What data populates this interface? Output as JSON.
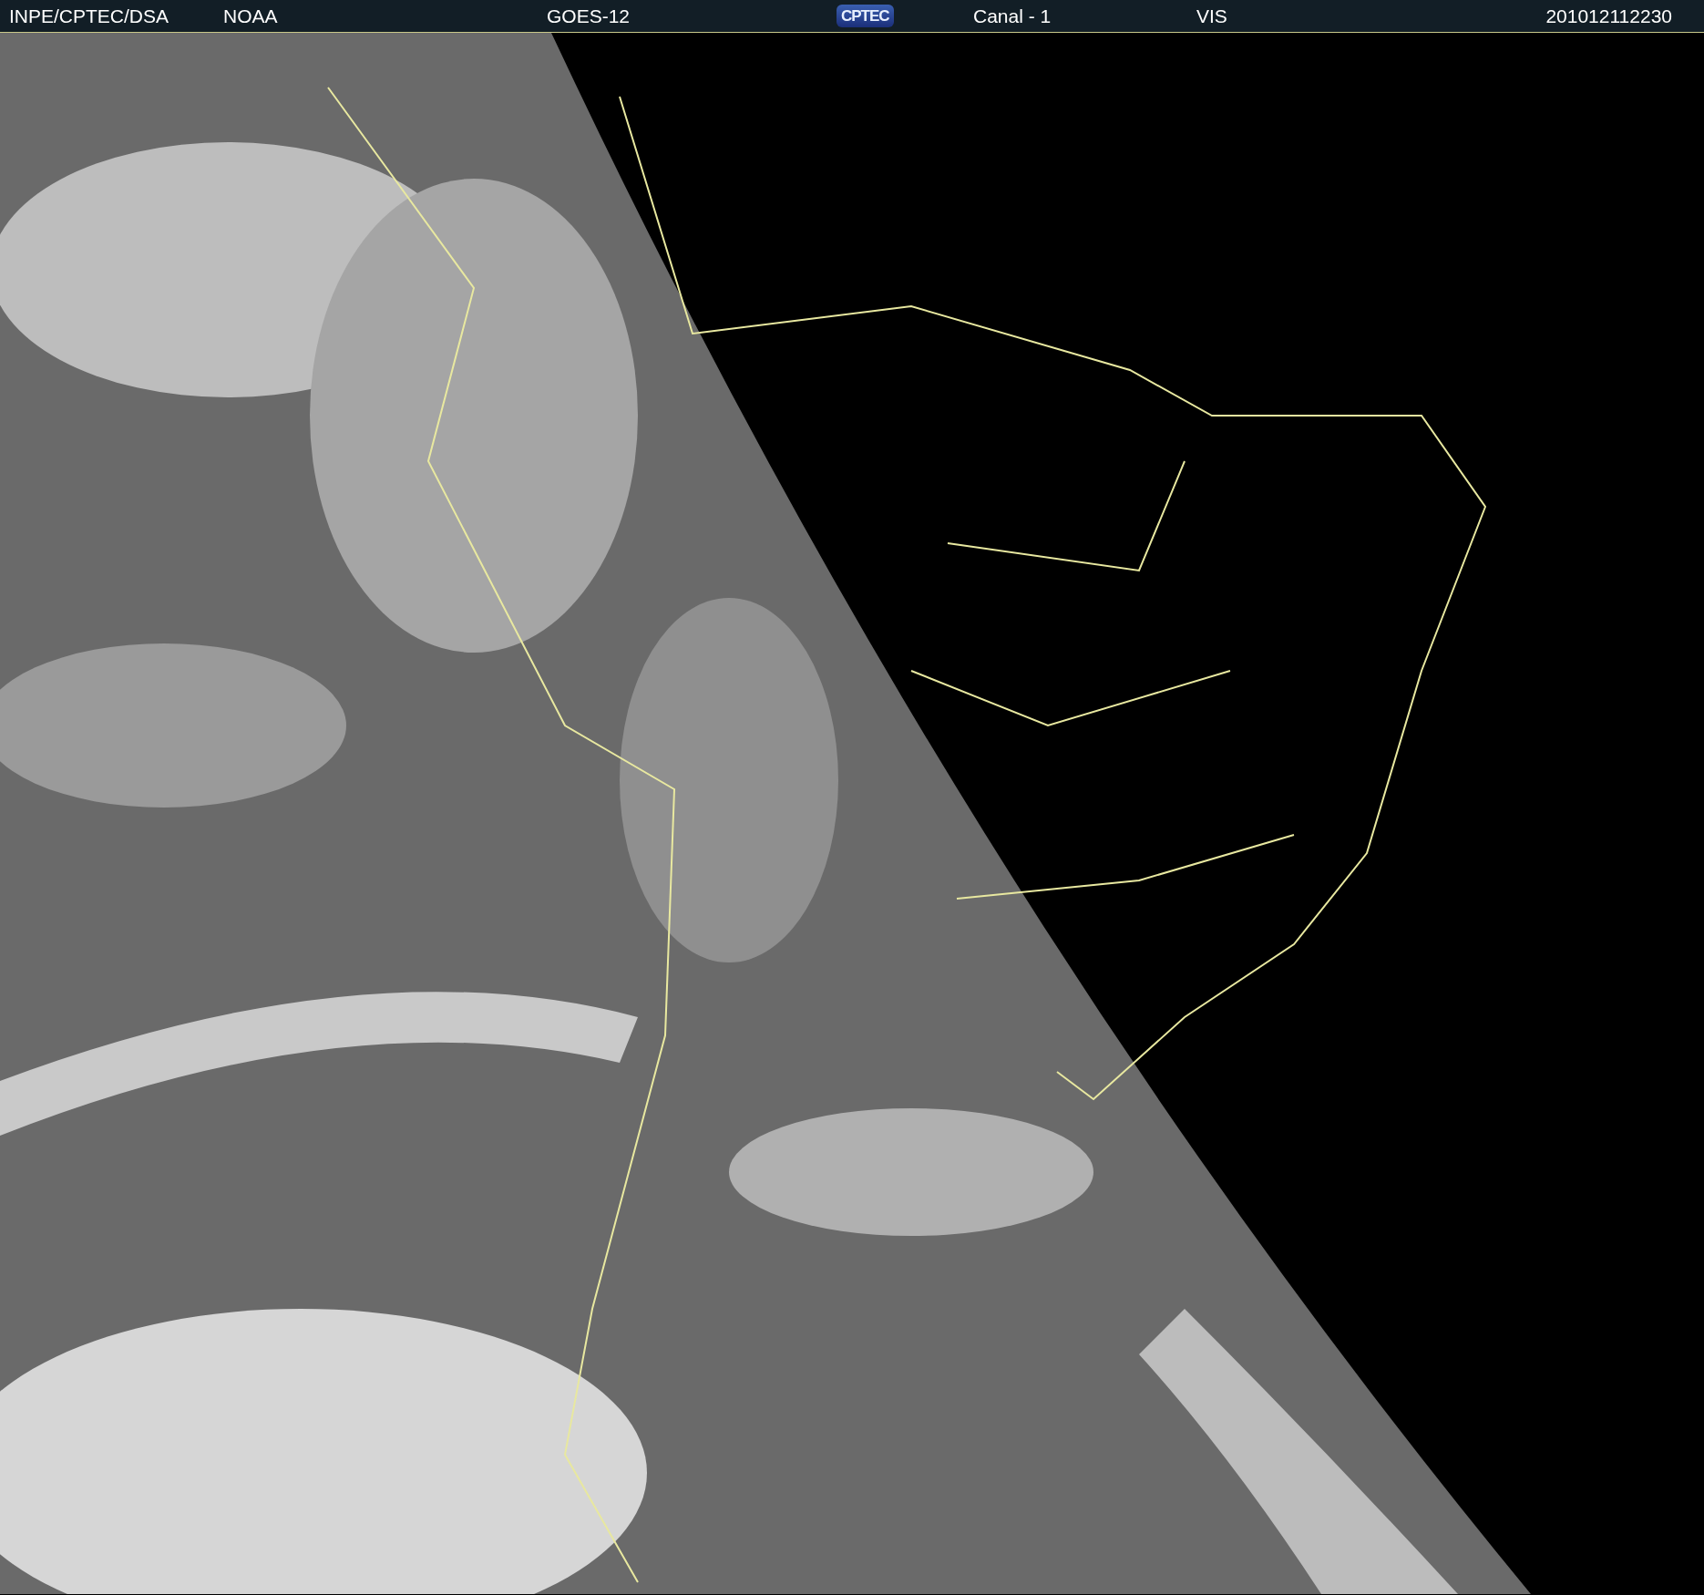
{
  "header": {
    "items": [
      {
        "kind": "text",
        "text": "INPE/CPTEC/DSA"
      },
      {
        "kind": "text",
        "text": "NOAA"
      },
      {
        "kind": "text",
        "text": "GOES-12"
      },
      {
        "kind": "logo",
        "text": "CPTEC"
      },
      {
        "kind": "text",
        "text": "Canal - 1"
      },
      {
        "kind": "text",
        "text": "VIS"
      },
      {
        "kind": "text",
        "text": "201012112230"
      }
    ]
  }
}
